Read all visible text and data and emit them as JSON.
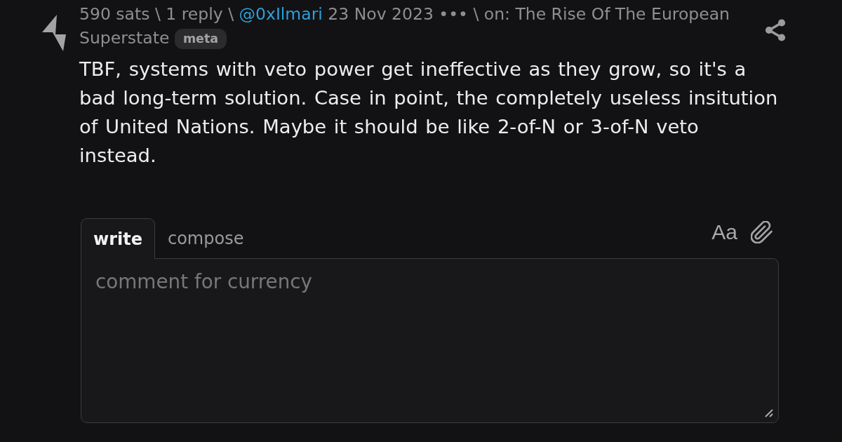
{
  "post": {
    "meta": [
      {
        "kind": "text",
        "text": "590 sats \\ 1 reply \\"
      },
      {
        "kind": "link",
        "text": "@0xIlmari"
      },
      {
        "kind": "text",
        "text": "23 Nov 2023 ••• \\ on: The Rise Of The European Superstate"
      },
      {
        "kind": "tag",
        "text": "meta"
      }
    ],
    "body": "TBF, systems with veto power get ineffective as they grow, so it's a bad long-term solution. Case in point, the completely useless insitution of United Nations. Maybe it should be like 2-of-N or 3-of-N veto instead."
  },
  "reply_form": {
    "tabs": [
      {
        "label": "write",
        "selected": true
      },
      {
        "label": "compose",
        "selected": false
      }
    ],
    "format_toggle": "Aa",
    "input": {
      "placeholder": "comment for currency"
    }
  }
}
